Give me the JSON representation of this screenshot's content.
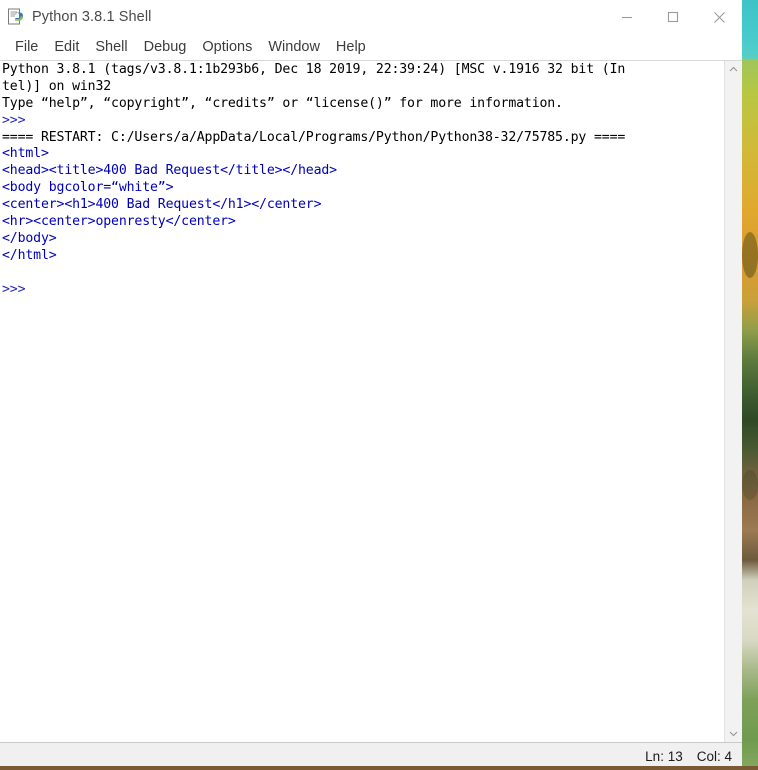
{
  "window": {
    "title": "Python 3.8.1 Shell",
    "icon": "python-idle-icon",
    "controls": {
      "minimize_label": "Minimize",
      "maximize_label": "Maximize",
      "close_label": "Close"
    }
  },
  "menu": {
    "items": [
      {
        "label": "File"
      },
      {
        "label": "Edit"
      },
      {
        "label": "Shell"
      },
      {
        "label": "Debug"
      },
      {
        "label": "Options"
      },
      {
        "label": "Window"
      },
      {
        "label": "Help"
      }
    ]
  },
  "shell": {
    "lines": [
      {
        "text": "Python 3.8.1 (tags/v3.8.1:1b293b6, Dec 18 2019, 22:39:24) [MSC v.1916 32 bit (In",
        "color": "black"
      },
      {
        "text": "tel)] on win32",
        "color": "black"
      },
      {
        "text": "Type “help”, “copyright”, “credits” or “license()” for more information.",
        "color": "black"
      },
      {
        "text": ">>>",
        "color": "prompt"
      },
      {
        "text": "==== RESTART: C:/Users/a/AppData/Local/Programs/Python/Python38-32/75785.py ====",
        "color": "black"
      },
      {
        "text": "<html>",
        "color": "blue"
      },
      {
        "text": "<head><title>400 Bad Request</title></head>",
        "color": "blue"
      },
      {
        "text": "<body bgcolor=“white”>",
        "color": "blue"
      },
      {
        "text": "<center><h1>400 Bad Request</h1></center>",
        "color": "blue"
      },
      {
        "text": "<hr><center>openresty</center>",
        "color": "blue"
      },
      {
        "text": "</body>",
        "color": "blue"
      },
      {
        "text": "</html>",
        "color": "blue"
      },
      {
        "text": "",
        "color": "black"
      },
      {
        "text": ">>>",
        "color": "prompt"
      }
    ]
  },
  "scrollbar": {
    "up_arrow_icon": "chevron-up-icon",
    "down_arrow_icon": "chevron-down-icon"
  },
  "status": {
    "line_label": "Ln: 13",
    "column_label": "Col: 4"
  },
  "colors": {
    "output_blue": "#0000bb",
    "prompt_blue": "#2727b0",
    "text_black": "#000000",
    "window_bg": "#ffffff",
    "statusbar_bg": "#f0f0f0",
    "desktop_teal": "#49cbcb"
  }
}
